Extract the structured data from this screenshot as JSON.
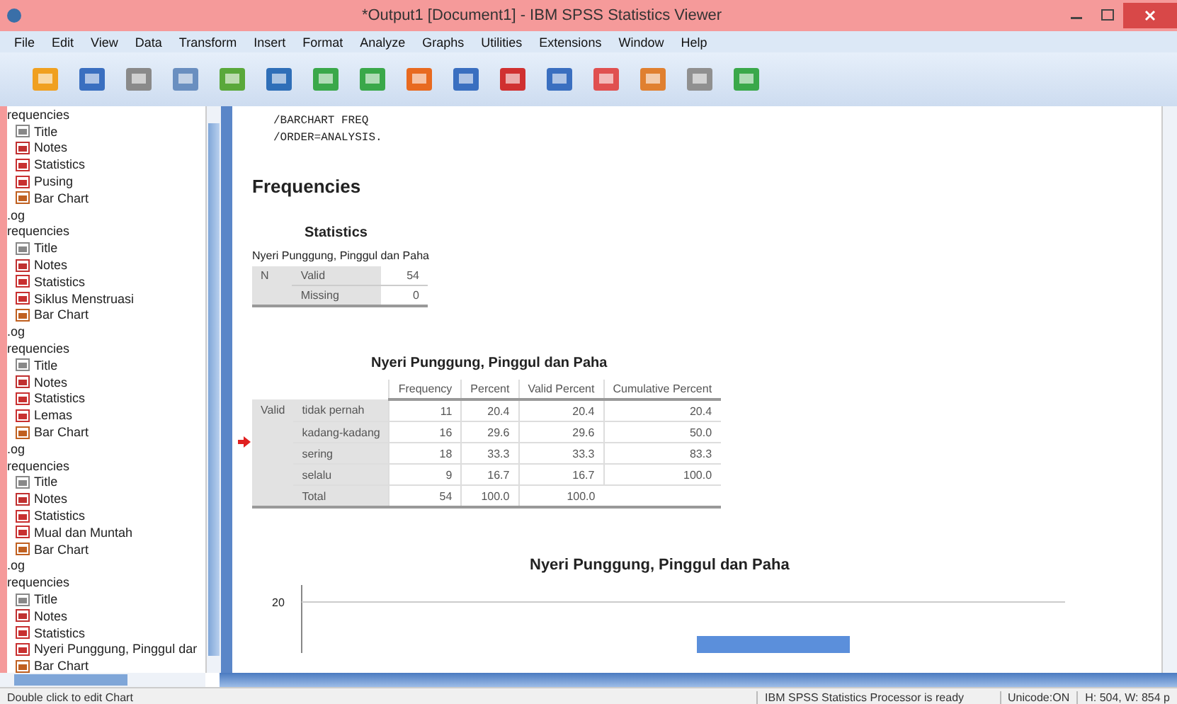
{
  "window": {
    "title": "*Output1 [Document1] - IBM SPSS Statistics Viewer"
  },
  "menu": [
    "File",
    "Edit",
    "View",
    "Data",
    "Transform",
    "Insert",
    "Format",
    "Analyze",
    "Graphs",
    "Utilities",
    "Extensions",
    "Window",
    "Help"
  ],
  "outline": [
    {
      "label": "requencies",
      "children": [
        {
          "label": "Title",
          "kind": "title"
        },
        {
          "label": "Notes",
          "kind": "notes"
        },
        {
          "label": "Statistics",
          "kind": "table"
        },
        {
          "label": "Pusing",
          "kind": "table"
        },
        {
          "label": "Bar Chart",
          "kind": "chart"
        }
      ]
    },
    {
      "label": ".og"
    },
    {
      "label": "requencies",
      "children": [
        {
          "label": "Title",
          "kind": "title"
        },
        {
          "label": "Notes",
          "kind": "notes"
        },
        {
          "label": "Statistics",
          "kind": "table"
        },
        {
          "label": "Siklus Menstruasi",
          "kind": "table"
        },
        {
          "label": "Bar Chart",
          "kind": "chart"
        }
      ]
    },
    {
      "label": ".og"
    },
    {
      "label": "requencies",
      "children": [
        {
          "label": "Title",
          "kind": "title"
        },
        {
          "label": "Notes",
          "kind": "notes"
        },
        {
          "label": "Statistics",
          "kind": "table"
        },
        {
          "label": "Lemas",
          "kind": "table"
        },
        {
          "label": "Bar Chart",
          "kind": "chart"
        }
      ]
    },
    {
      "label": ".og"
    },
    {
      "label": "requencies",
      "children": [
        {
          "label": "Title",
          "kind": "title"
        },
        {
          "label": "Notes",
          "kind": "notes"
        },
        {
          "label": "Statistics",
          "kind": "table"
        },
        {
          "label": "Mual dan Muntah",
          "kind": "table"
        },
        {
          "label": "Bar Chart",
          "kind": "chart"
        }
      ]
    },
    {
      "label": ".og"
    },
    {
      "label": "requencies",
      "children": [
        {
          "label": "Title",
          "kind": "title"
        },
        {
          "label": "Notes",
          "kind": "notes"
        },
        {
          "label": "Statistics",
          "kind": "table"
        },
        {
          "label": "Nyeri Punggung, Pinggul dar",
          "kind": "table"
        },
        {
          "label": "Bar Chart",
          "kind": "chart"
        }
      ]
    }
  ],
  "syntax": [
    "/BARCHART FREQ",
    "/ORDER=ANALYSIS."
  ],
  "heading": "Frequencies",
  "statistics": {
    "title": "Statistics",
    "variable": "Nyeri Punggung, Pinggul dan Paha",
    "rows": [
      {
        "group": "N",
        "label": "Valid",
        "value": "54"
      },
      {
        "label": "Missing",
        "value": "0"
      }
    ]
  },
  "frequency_table": {
    "title": "Nyeri Punggung, Pinggul dan Paha",
    "columns": [
      "Frequency",
      "Percent",
      "Valid Percent",
      "Cumulative Percent"
    ],
    "row_group": "Valid",
    "rows": [
      {
        "label": "tidak pernah",
        "cells": [
          "11",
          "20.4",
          "20.4",
          "20.4"
        ]
      },
      {
        "label": "kadang-kadang",
        "cells": [
          "16",
          "29.6",
          "29.6",
          "50.0"
        ]
      },
      {
        "label": "sering",
        "cells": [
          "18",
          "33.3",
          "33.3",
          "83.3"
        ]
      },
      {
        "label": "selalu",
        "cells": [
          "9",
          "16.7",
          "16.7",
          "100.0"
        ]
      },
      {
        "label": "Total",
        "cells": [
          "54",
          "100.0",
          "100.0"
        ]
      }
    ]
  },
  "chart": {
    "title": "Nyeri Punggung, Pinggul dan Paha",
    "tick_label": "20"
  },
  "status_bar": {
    "hint": "Double click to edit Chart",
    "processor": "IBM SPSS Statistics Processor is ready",
    "unicode": "Unicode:ON",
    "size": "H: 504, W: 854 p"
  }
}
